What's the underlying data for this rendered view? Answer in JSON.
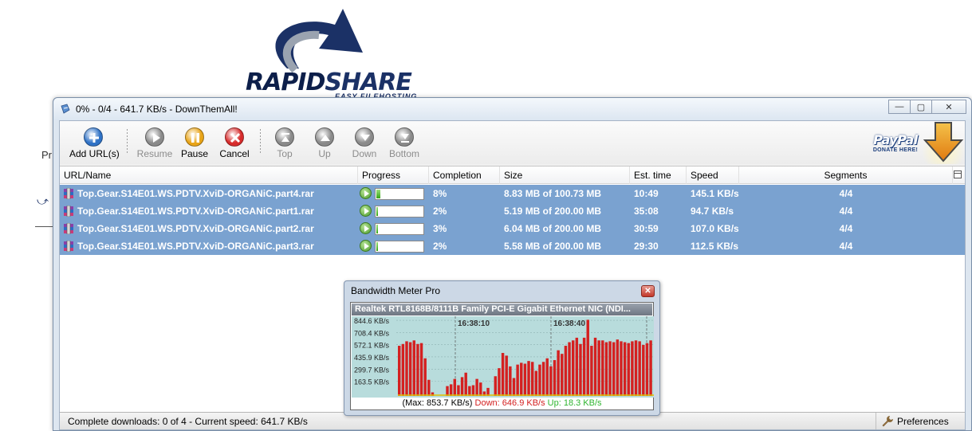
{
  "background": {
    "logo_word_a": "RAPID",
    "logo_word_b": "SHARE",
    "logo_tagline": "EASY FILEHOSTING",
    "fragment": "Pr"
  },
  "window": {
    "title": "0% - 0/4 - 641.7 KB/s - DownThemAll!",
    "minimize": "—",
    "maximize": "▢",
    "close": "✕"
  },
  "toolbar": {
    "buttons": [
      {
        "label": "Add URL(s)",
        "icon": "add-icon",
        "color": "#2f72c6",
        "enabled": true
      },
      {
        "label": "Resume",
        "icon": "play-icon",
        "color": "#8a8a8a",
        "enabled": false
      },
      {
        "label": "Pause",
        "icon": "pause-icon",
        "color": "#e8a418",
        "enabled": true
      },
      {
        "label": "Cancel",
        "icon": "cancel-icon",
        "color": "#d72b2b",
        "enabled": true
      },
      {
        "label": "Top",
        "icon": "move-top-icon",
        "color": "#8a8a8a",
        "enabled": false
      },
      {
        "label": "Up",
        "icon": "move-up-icon",
        "color": "#8a8a8a",
        "enabled": false
      },
      {
        "label": "Down",
        "icon": "move-down-icon",
        "color": "#8a8a8a",
        "enabled": false
      },
      {
        "label": "Bottom",
        "icon": "move-bottom-icon",
        "color": "#8a8a8a",
        "enabled": false
      }
    ],
    "paypal": {
      "logo": "PayPal",
      "cta": "DONATE HERE!"
    }
  },
  "table": {
    "columns": [
      "URL/Name",
      "Progress",
      "Completion",
      "Size",
      "Est. time",
      "Speed",
      "Segments"
    ],
    "rows": [
      {
        "name": "Top.Gear.S14E01.WS.PDTV.XviD-ORGANiC.part4.rar",
        "progress": 8,
        "completion": "8%",
        "size": "8.83 MB of 100.73 MB",
        "eta": "10:49",
        "speed": "145.1 KB/s",
        "segments": "4/4"
      },
      {
        "name": "Top.Gear.S14E01.WS.PDTV.XviD-ORGANiC.part1.rar",
        "progress": 2,
        "completion": "2%",
        "size": "5.19 MB of 200.00 MB",
        "eta": "35:08",
        "speed": "94.7 KB/s",
        "segments": "4/4"
      },
      {
        "name": "Top.Gear.S14E01.WS.PDTV.XviD-ORGANiC.part2.rar",
        "progress": 3,
        "completion": "3%",
        "size": "6.04 MB of 200.00 MB",
        "eta": "30:59",
        "speed": "107.0 KB/s",
        "segments": "4/4"
      },
      {
        "name": "Top.Gear.S14E01.WS.PDTV.XviD-ORGANiC.part3.rar",
        "progress": 2,
        "completion": "2%",
        "size": "5.58 MB of 200.00 MB",
        "eta": "29:30",
        "speed": "112.5 KB/s",
        "segments": "4/4"
      }
    ],
    "selection_color": "#7aa2d0"
  },
  "statusbar": {
    "text": "Complete downloads: 0 of 4 - Current speed: 641.7 KB/s",
    "preferences": "Preferences"
  },
  "bandwidth_meter": {
    "title": "Bandwidth Meter Pro",
    "close": "✕",
    "adapter": "Realtek RTL8168B/8111B Family PCI-E Gigabit Ethernet NIC (NDI...",
    "y_ticks": [
      "844.6 KB/s",
      "708.4 KB/s",
      "572.1 KB/s",
      "435.9 KB/s",
      "299.7 KB/s",
      "163.5 KB/s"
    ],
    "time_labels": [
      "16:38:10",
      "16:38:40"
    ],
    "max_label": "(Max: 853.7 KB/s)",
    "down_label": "Down: 646.9 KB/s",
    "up_label": "Up: 18.3 KB/s",
    "down_color": "#d42020",
    "up_color": "#2eb52e",
    "down_values": [
      560,
      580,
      610,
      600,
      620,
      580,
      590,
      420,
      180,
      40,
      0,
      0,
      0,
      110,
      130,
      190,
      120,
      210,
      260,
      110,
      120,
      190,
      150,
      50,
      90,
      0,
      220,
      310,
      480,
      450,
      330,
      200,
      350,
      370,
      360,
      390,
      380,
      280,
      350,
      380,
      420,
      330,
      400,
      510,
      470,
      560,
      600,
      620,
      650,
      580,
      650,
      850,
      560,
      650,
      620,
      620,
      600,
      610,
      600,
      630,
      610,
      600,
      590,
      610,
      620,
      610,
      570,
      590,
      620
    ]
  }
}
